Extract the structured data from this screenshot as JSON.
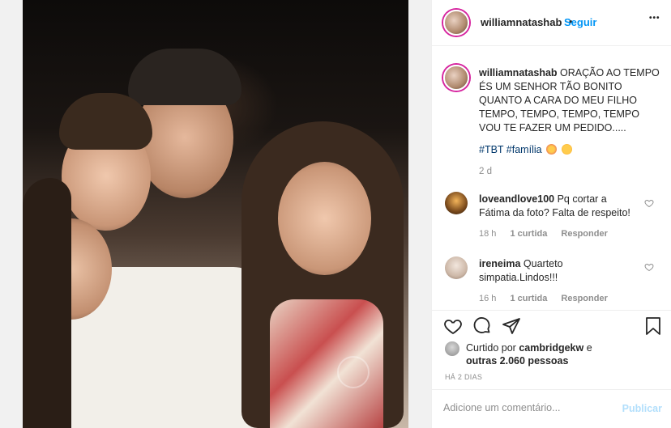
{
  "post": {
    "image_alt": "Family photo of a man with three children",
    "watermark": "Globo"
  },
  "header": {
    "username": "williamnatashab",
    "separator": "•",
    "follow_label": "Seguir",
    "more_label": "•••"
  },
  "caption": {
    "username": "williamnatashab",
    "lines": [
      "ORAÇÃO AO TEMPO",
      "ÉS UM SENHOR TÃO BONITO",
      "QUANTO A CARA DO MEU FILHO",
      "TEMPO, TEMPO, TEMPO, TEMPO",
      "VOU TE FAZER UM PEDIDO....."
    ],
    "hashtags": "#TBT #família",
    "time": "2 d"
  },
  "comments": [
    {
      "username": "loveandlove100",
      "text_line1": "Pq cortar a",
      "text_line2": "Fátima da foto? Falta de respeito!",
      "time": "18 h",
      "likes": "1 curtida",
      "reply": "Responder"
    },
    {
      "username": "ireneima",
      "text_line1": "Quarteto",
      "text_line2": "simpatia.Lindos!!!",
      "time": "16 h",
      "likes": "1 curtida",
      "reply": "Responder"
    }
  ],
  "likes": {
    "prefix": "Curtido por",
    "user": "cambridgekw",
    "suffix": "e",
    "others": "outras 2.060 pessoas"
  },
  "time_ago": "HÁ 2 DIAS",
  "comment_box": {
    "placeholder": "Adicione um comentário...",
    "publish_label": "Publicar"
  },
  "colors": {
    "link": "#0095f6",
    "hashtag": "#00376b",
    "muted": "#8e8e8e",
    "publish_disabled": "#b2dffc"
  }
}
